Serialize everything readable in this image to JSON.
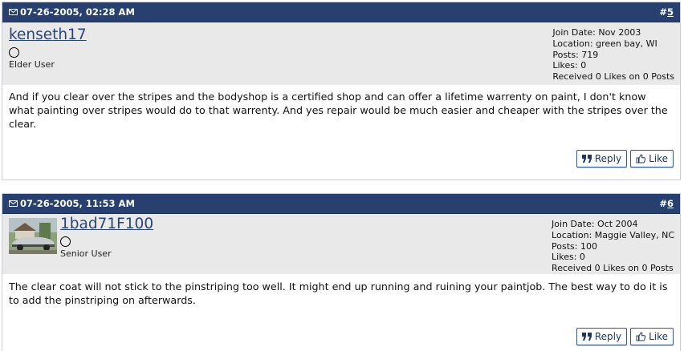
{
  "posts": [
    {
      "timestamp": "07-26-2005, 02:28 AM",
      "post_prefix": "#",
      "post_number": "5",
      "username": "kenseth17",
      "user_title": "Elder User",
      "info": {
        "join_date": "Join Date: Nov 2003",
        "location": "Location: green bay, WI",
        "posts": "Posts: 719",
        "likes": "Likes: 0",
        "received": "Received 0 Likes on 0 Posts"
      },
      "body": "And if you clear over the stripes and the bodyshop is a certified shop and can offer a lifetime warrenty on paint, I don't know what painting over stripes would do to that warrenty. And yes repair would be much easier and cheaper with the stripes over the clear.",
      "reply_label": "Reply",
      "like_label": "Like"
    },
    {
      "timestamp": "07-26-2005, 11:53 AM",
      "post_prefix": "#",
      "post_number": "6",
      "username": "1bad71F100",
      "user_title": "Senior User",
      "info": {
        "join_date": "Join Date: Oct 2004",
        "location": "Location: Maggie Valley, NC",
        "posts": "Posts: 100",
        "likes": "Likes: 0",
        "received": "Received 0 Likes on 0 Posts"
      },
      "body": "The clear coat will not stick to the pinstriping too well. It might end up running and ruining your paintjob. The best way to do it is to add the pinstriping on afterwards.",
      "reply_label": "Reply",
      "like_label": "Like"
    }
  ],
  "colors": {
    "header_bg": "#27406f",
    "userbar_bg": "#e9e9e9",
    "link": "#28457a"
  }
}
